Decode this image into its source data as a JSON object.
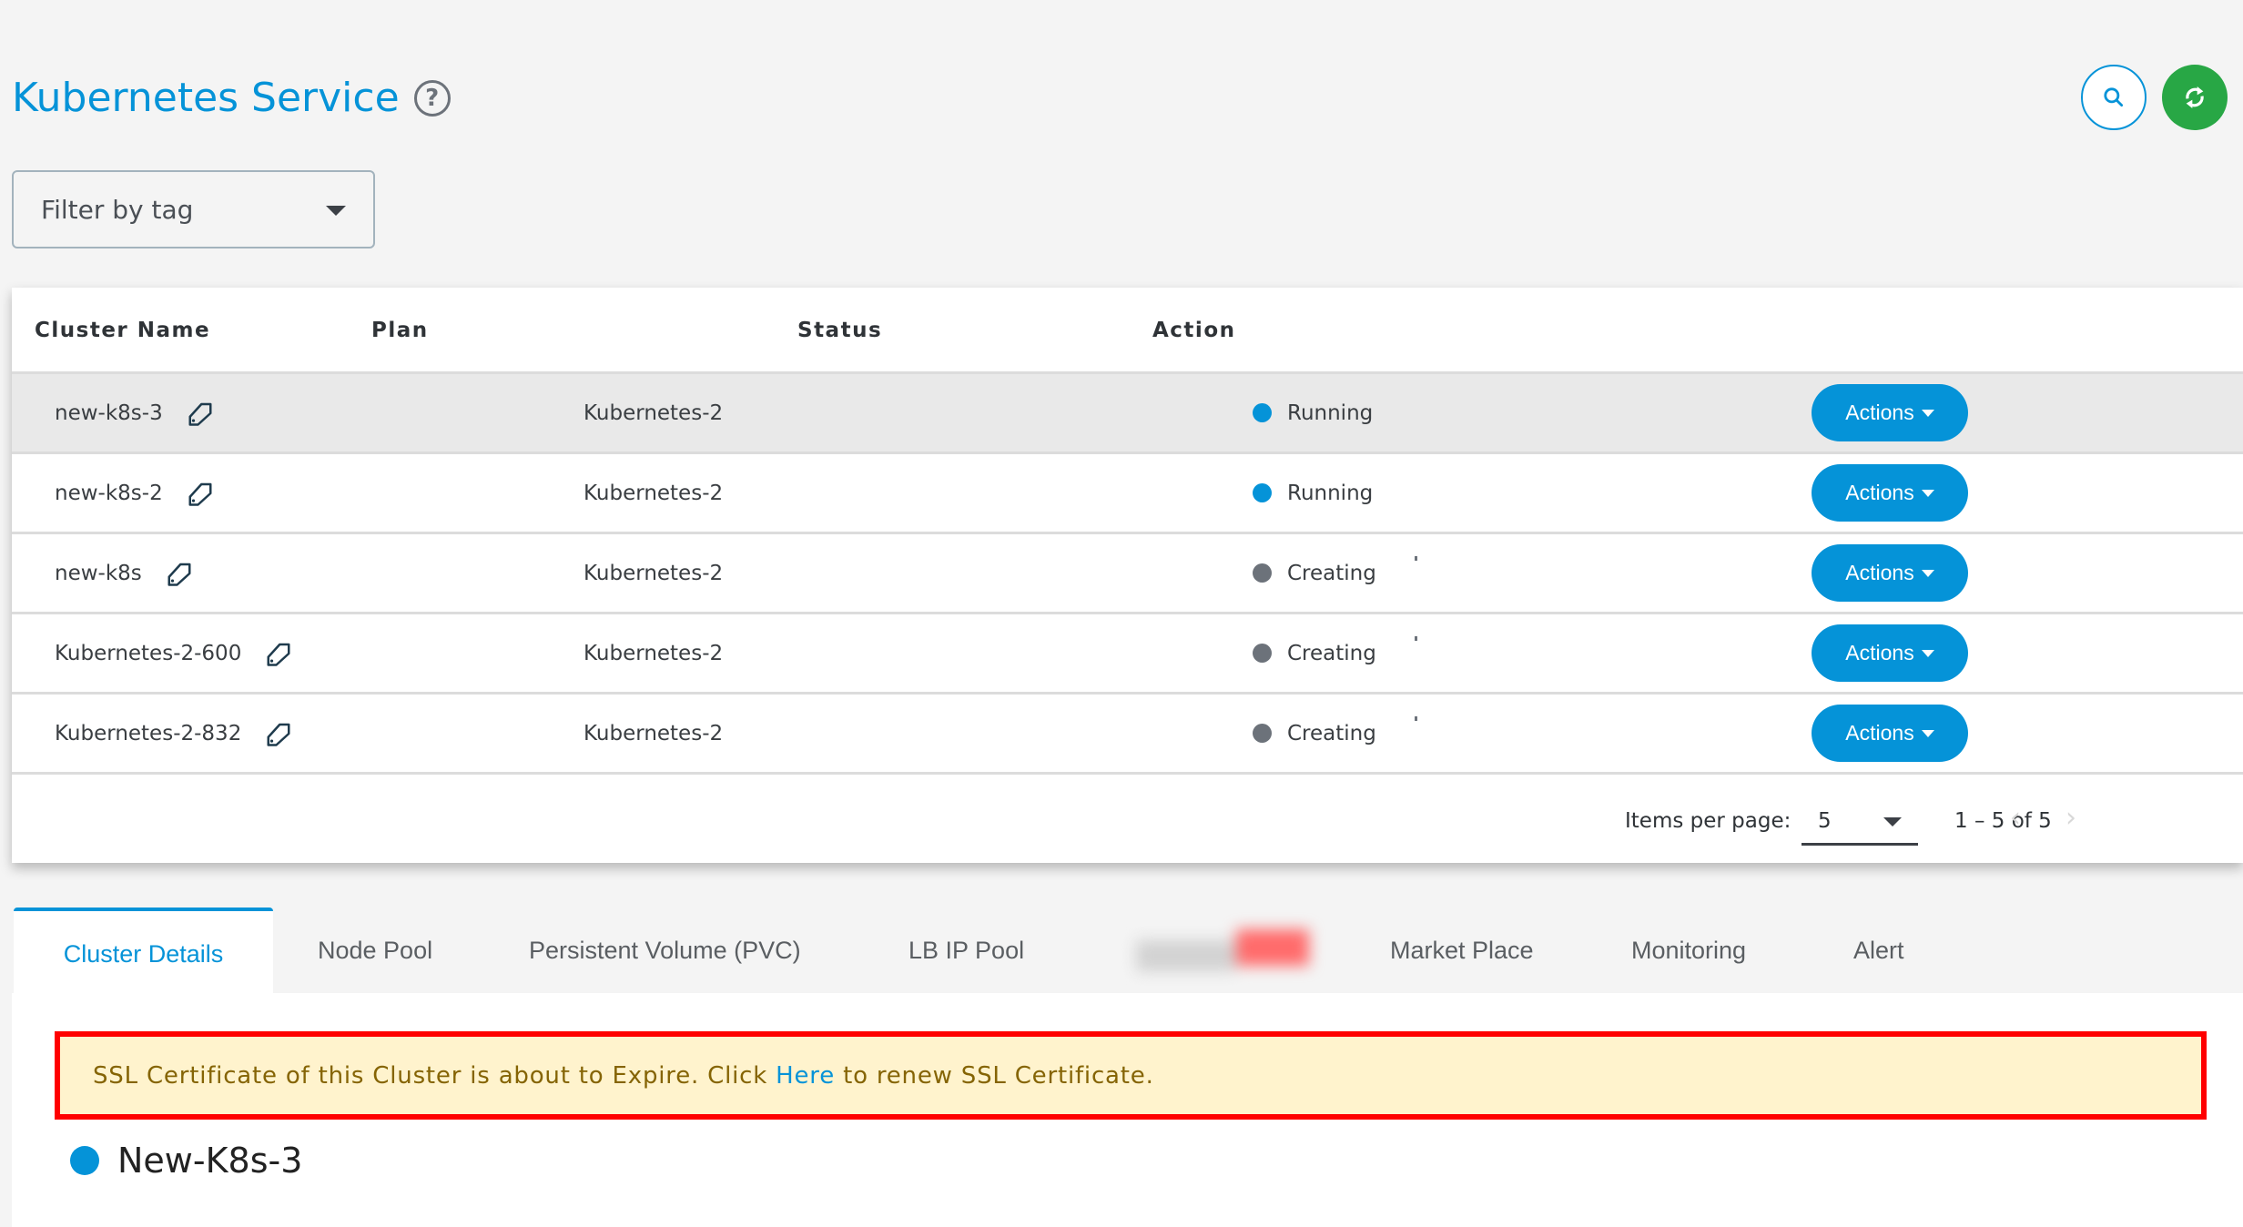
{
  "header": {
    "title": "Kubernetes Service",
    "help_icon": "question-circle-icon",
    "search_icon": "search-icon",
    "refresh_icon": "refresh-icon"
  },
  "filter": {
    "label": "Filter by tag"
  },
  "colors": {
    "accent": "#0593d8",
    "running": "#0593d8",
    "creating": "#6c727a",
    "refresh": "#28a745",
    "alert_bg": "#fff3cd",
    "alert_border": "#ff0000"
  },
  "table": {
    "columns": [
      "Cluster Name",
      "Plan",
      "Status",
      "Action"
    ],
    "rows": [
      {
        "name": "new-k8s-3",
        "plan": "Kubernetes-2",
        "status": "Running",
        "action": "Actions"
      },
      {
        "name": "new-k8s-2",
        "plan": "Kubernetes-2",
        "status": "Running",
        "action": "Actions"
      },
      {
        "name": "new-k8s",
        "plan": "Kubernetes-2",
        "status": "Creating",
        "action": "Actions"
      },
      {
        "name": "Kubernetes-2-600",
        "plan": "Kubernetes-2",
        "status": "Creating",
        "action": "Actions"
      },
      {
        "name": "Kubernetes-2-832",
        "plan": "Kubernetes-2",
        "status": "Creating",
        "action": "Actions"
      }
    ]
  },
  "pagination": {
    "items_per_page_label": "Items per page:",
    "items_per_page": "5",
    "range": "1 – 5 of 5",
    "prev": "‹",
    "next": "›"
  },
  "tabs": [
    {
      "label": "Cluster Details",
      "active": true
    },
    {
      "label": "Node Pool"
    },
    {
      "label": "Persistent Volume (PVC)"
    },
    {
      "label": "LB IP Pool"
    },
    {
      "label": ""
    },
    {
      "label": "Market Place"
    },
    {
      "label": "Monitoring"
    },
    {
      "label": "Alert"
    }
  ],
  "alert": {
    "before": "SSL Certificate of this Cluster is about to Expire. Click ",
    "link": "Here",
    "after": " to renew SSL Certificate."
  },
  "cluster": {
    "name": "New-K8s-3"
  }
}
